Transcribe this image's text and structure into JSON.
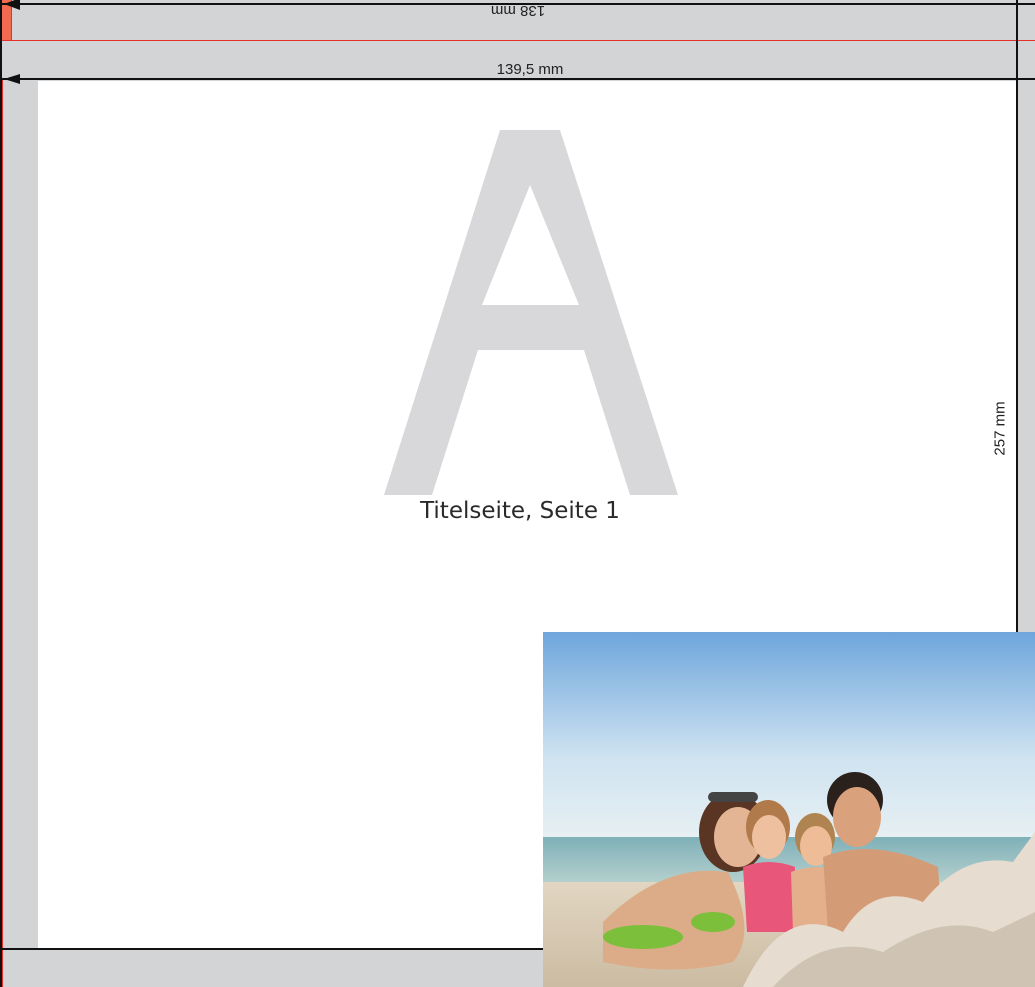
{
  "dimensions": {
    "top_width": "138 mm",
    "spread_width": "139,5 mm",
    "height": "257 mm"
  },
  "page": {
    "watermark_letter": "A",
    "label": "Titelseite, Seite 1"
  },
  "colors": {
    "bleed_gray": "#d3d4d6",
    "guide_red": "#e8302a",
    "corner_orange": "#f26a4f",
    "watermark_gray": "#d8d8da"
  },
  "photo": {
    "subject": "family-on-beach"
  }
}
